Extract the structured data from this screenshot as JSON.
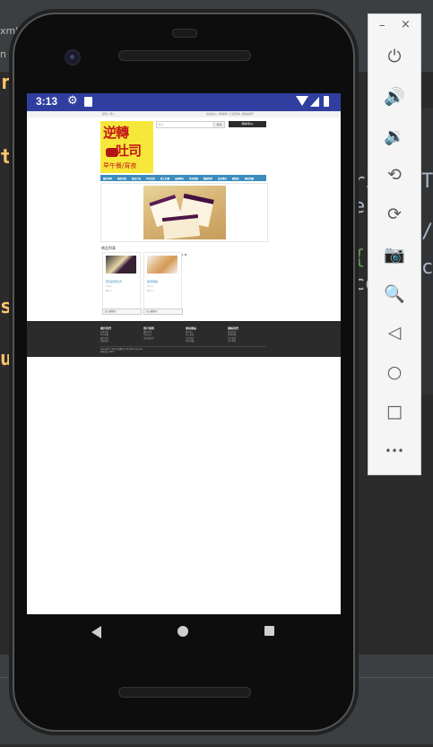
{
  "ide": {
    "tab_label": "xml",
    "tab2_label": "n th",
    "left_glyphs": [
      "r",
      "t,",
      "s",
      "u"
    ],
    "right_code": [
      "ri",
      "T",
      "e",
      "/",
      "{",
      "co",
      "co"
    ]
  },
  "status_bar": {
    "time": "3:13",
    "gear_icon": "gear-icon",
    "sd_icon": "sd-card-icon",
    "wifi_icon": "wifi-icon",
    "cell_icon": "cell-signal-icon",
    "battery_icon": "battery-icon"
  },
  "site": {
    "topbar_left": "首頁 | 登入",
    "topbar_right": "會員中心 | 購物車 | 訂單查詢 | 聯絡我們",
    "logo": {
      "line1": "逆轉",
      "line2": "吐司",
      "line3": "早午餐/宵夜"
    },
    "search_placeholder": "搜尋",
    "search_button": "搜尋",
    "cart_button": "購物車(0)",
    "menu": [
      "關於我們",
      "最新消息",
      "產品介紹",
      "門市資訊",
      "線上訂購",
      "加盟專區",
      "常見問題",
      "聯絡我們",
      "會員專區",
      "購物車",
      "網站地圖"
    ],
    "section_title": "商品列表",
    "products": [
      {
        "name": "藍莓起司吐司",
        "meta1": "NT$ 60",
        "meta2": "庫存 99",
        "button": "加入購物車"
      },
      {
        "name": "起司蛋餅",
        "meta1": "NT$ 50",
        "meta2": "庫存 99",
        "button": "加入購物車"
      }
    ],
    "footer": {
      "columns": [
        {
          "heading": "關於我們",
          "links": [
            "品牌故事",
            "門市據點",
            "最新消息",
            "加盟資訊"
          ]
        },
        {
          "heading": "客戶服務",
          "links": [
            "購物說明",
            "付款方式",
            "退換貨說明"
          ]
        },
        {
          "heading": "會員專區",
          "links": [
            "會員登入",
            "加入會員",
            "訂單查詢",
            "常見問題"
          ]
        },
        {
          "heading": "聯絡我們",
          "links": [
            "客服信箱",
            "營業時間",
            "門市電話",
            "合作提案"
          ]
        }
      ],
      "copyright_1": "Copyright © 2019 逆轉吐司 All rights reserved.",
      "copyright_2": "網站設計 NEXT"
    }
  },
  "emulator_toolbar": {
    "minimize_label": "–",
    "close_label": "×",
    "buttons": [
      {
        "name": "power-icon",
        "glyph": "⏻"
      },
      {
        "name": "volume-up-icon",
        "glyph": "🔊"
      },
      {
        "name": "volume-down-icon",
        "glyph": "🔉"
      },
      {
        "name": "rotate-left-icon",
        "glyph": "⟲"
      },
      {
        "name": "rotate-right-icon",
        "glyph": "⟳"
      },
      {
        "name": "camera-icon",
        "glyph": "📷"
      },
      {
        "name": "zoom-icon",
        "glyph": "🔍"
      },
      {
        "name": "back-icon",
        "glyph": "◁"
      },
      {
        "name": "home-icon",
        "glyph": "○"
      },
      {
        "name": "overview-icon",
        "glyph": "□"
      },
      {
        "name": "more-icon",
        "glyph": "•••"
      }
    ]
  }
}
